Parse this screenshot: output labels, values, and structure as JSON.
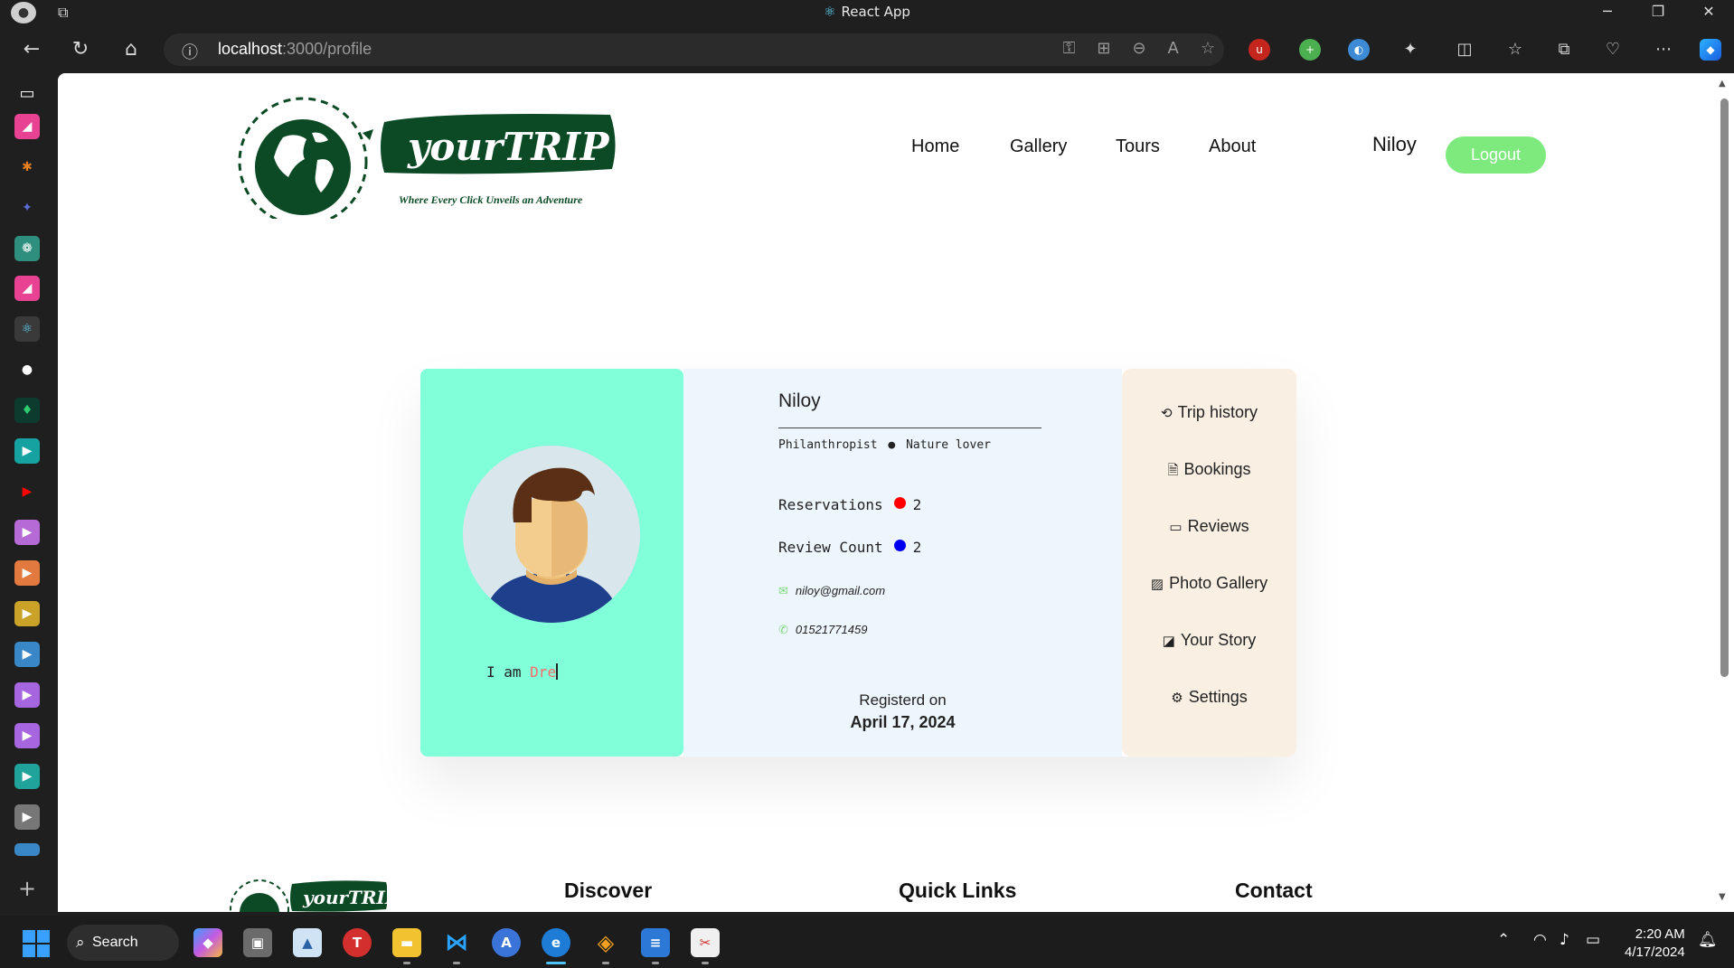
{
  "window": {
    "title": "React App"
  },
  "browser": {
    "url_host": "localhost",
    "url_rest": ":3000/profile"
  },
  "site": {
    "logo_text": "yourTRIP",
    "logo_tagline": "Where Every Click Unveils an Adventure",
    "nav": [
      "Home",
      "Gallery",
      "Tours",
      "About"
    ],
    "username": "Niloy",
    "logout_label": "Logout"
  },
  "profile": {
    "typing_prefix": "I am ",
    "typing_text": "Dre",
    "name": "Niloy",
    "tag1": "Philanthropist",
    "tag2": "Nature lover",
    "reservations_label": "Reservations",
    "reservations_value": "2",
    "review_label": "Review Count",
    "review_value": "2",
    "email": "niloy@gmail.com",
    "phone": "01521771459",
    "registered_label": "Registerd on",
    "registered_date": "April 17, 2024",
    "colors": {
      "reservations_dot": "#ff0000",
      "review_dot": "#0000ee",
      "left_panel": "#80ffd8"
    }
  },
  "menu": [
    "Trip history",
    "Bookings",
    "Reviews",
    "Photo Gallery",
    "Your Story",
    "Settings"
  ],
  "footer": {
    "logo_text": "yourTRIP",
    "headings": [
      "Discover",
      "Quick Links",
      "Contact"
    ]
  },
  "taskbar": {
    "search_label": "Search",
    "time": "2:20 AM",
    "date": "4/17/2024"
  }
}
